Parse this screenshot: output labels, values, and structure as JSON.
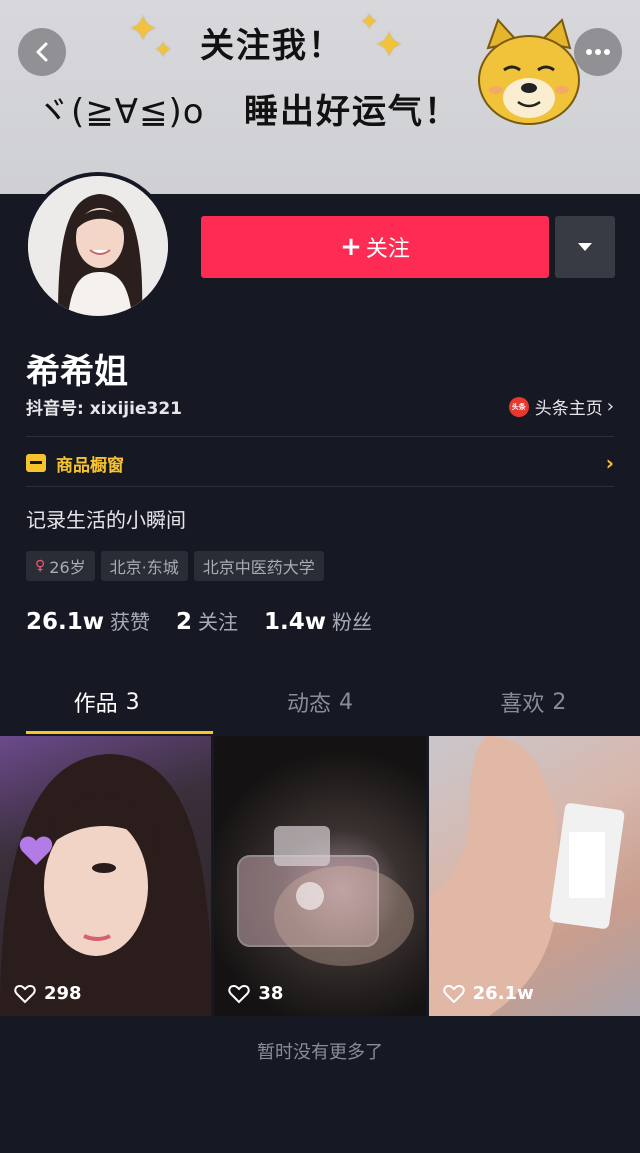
{
  "banner": {
    "line1": "关注我！",
    "kaomoji": "ヾ(≧∀≦)o",
    "line2": "睡出好运气！"
  },
  "header": {
    "follow_label": "关注",
    "nickname": "希希姐",
    "douyin_id": "抖音号: xixijie321",
    "toutiao_badge": "头条",
    "toutiao_label": "头条主页",
    "shop_label": "商品橱窗",
    "bio": "记录生活的小瞬间",
    "tags": [
      {
        "label": "26岁",
        "gender": "female"
      },
      {
        "label": "北京·东城"
      },
      {
        "label": "北京中医药大学"
      }
    ],
    "stats": [
      {
        "value": "26.1w",
        "label": "获赞"
      },
      {
        "value": "2",
        "label": "关注"
      },
      {
        "value": "1.4w",
        "label": "粉丝"
      }
    ]
  },
  "tabs": [
    {
      "label": "作品",
      "count": "3",
      "active": true
    },
    {
      "label": "动态",
      "count": "4",
      "active": false
    },
    {
      "label": "喜欢",
      "count": "2",
      "active": false
    }
  ],
  "videos": [
    {
      "likes": "298"
    },
    {
      "likes": "38"
    },
    {
      "likes": "26.1w"
    }
  ],
  "footer_note": "暂时没有更多了",
  "colors": {
    "background": "#161824",
    "follow_button": "#fe2c55",
    "accent_yellow": "#f8c42e",
    "secondary_text": "#a9abb4"
  },
  "icons": [
    "back-arrow-icon",
    "more-dots-icon",
    "dropdown-triangle-icon",
    "toutiao-logo-icon",
    "shop-icon",
    "female-icon",
    "heart-icon"
  ]
}
